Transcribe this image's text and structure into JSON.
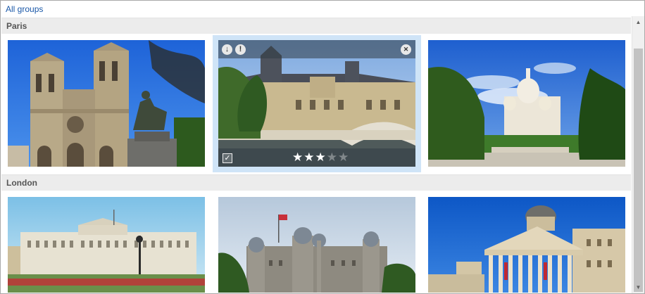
{
  "toolbar": {
    "all_groups_link": "All groups"
  },
  "groups": [
    {
      "name": "Paris",
      "photos": [
        "notre-dame",
        "louvre",
        "sacre-coeur"
      ]
    },
    {
      "name": "London",
      "photos": [
        "buckingham-palace",
        "tower-of-london",
        "national-gallery"
      ]
    }
  ],
  "selected_photo": {
    "group": "Paris",
    "index": 1,
    "rating": 3,
    "rating_max": 5,
    "checked": true,
    "icons": [
      "download-icon",
      "info-icon",
      "close-icon"
    ]
  },
  "glyphs": {
    "download": "↓",
    "info": "!",
    "close": "✕",
    "check": "✓",
    "star": "★",
    "scroll_up": "▲",
    "scroll_down": "▼"
  },
  "colors": {
    "link": "#1a58a8",
    "group_header": "#ececec",
    "selection": "#cfe4f7"
  }
}
